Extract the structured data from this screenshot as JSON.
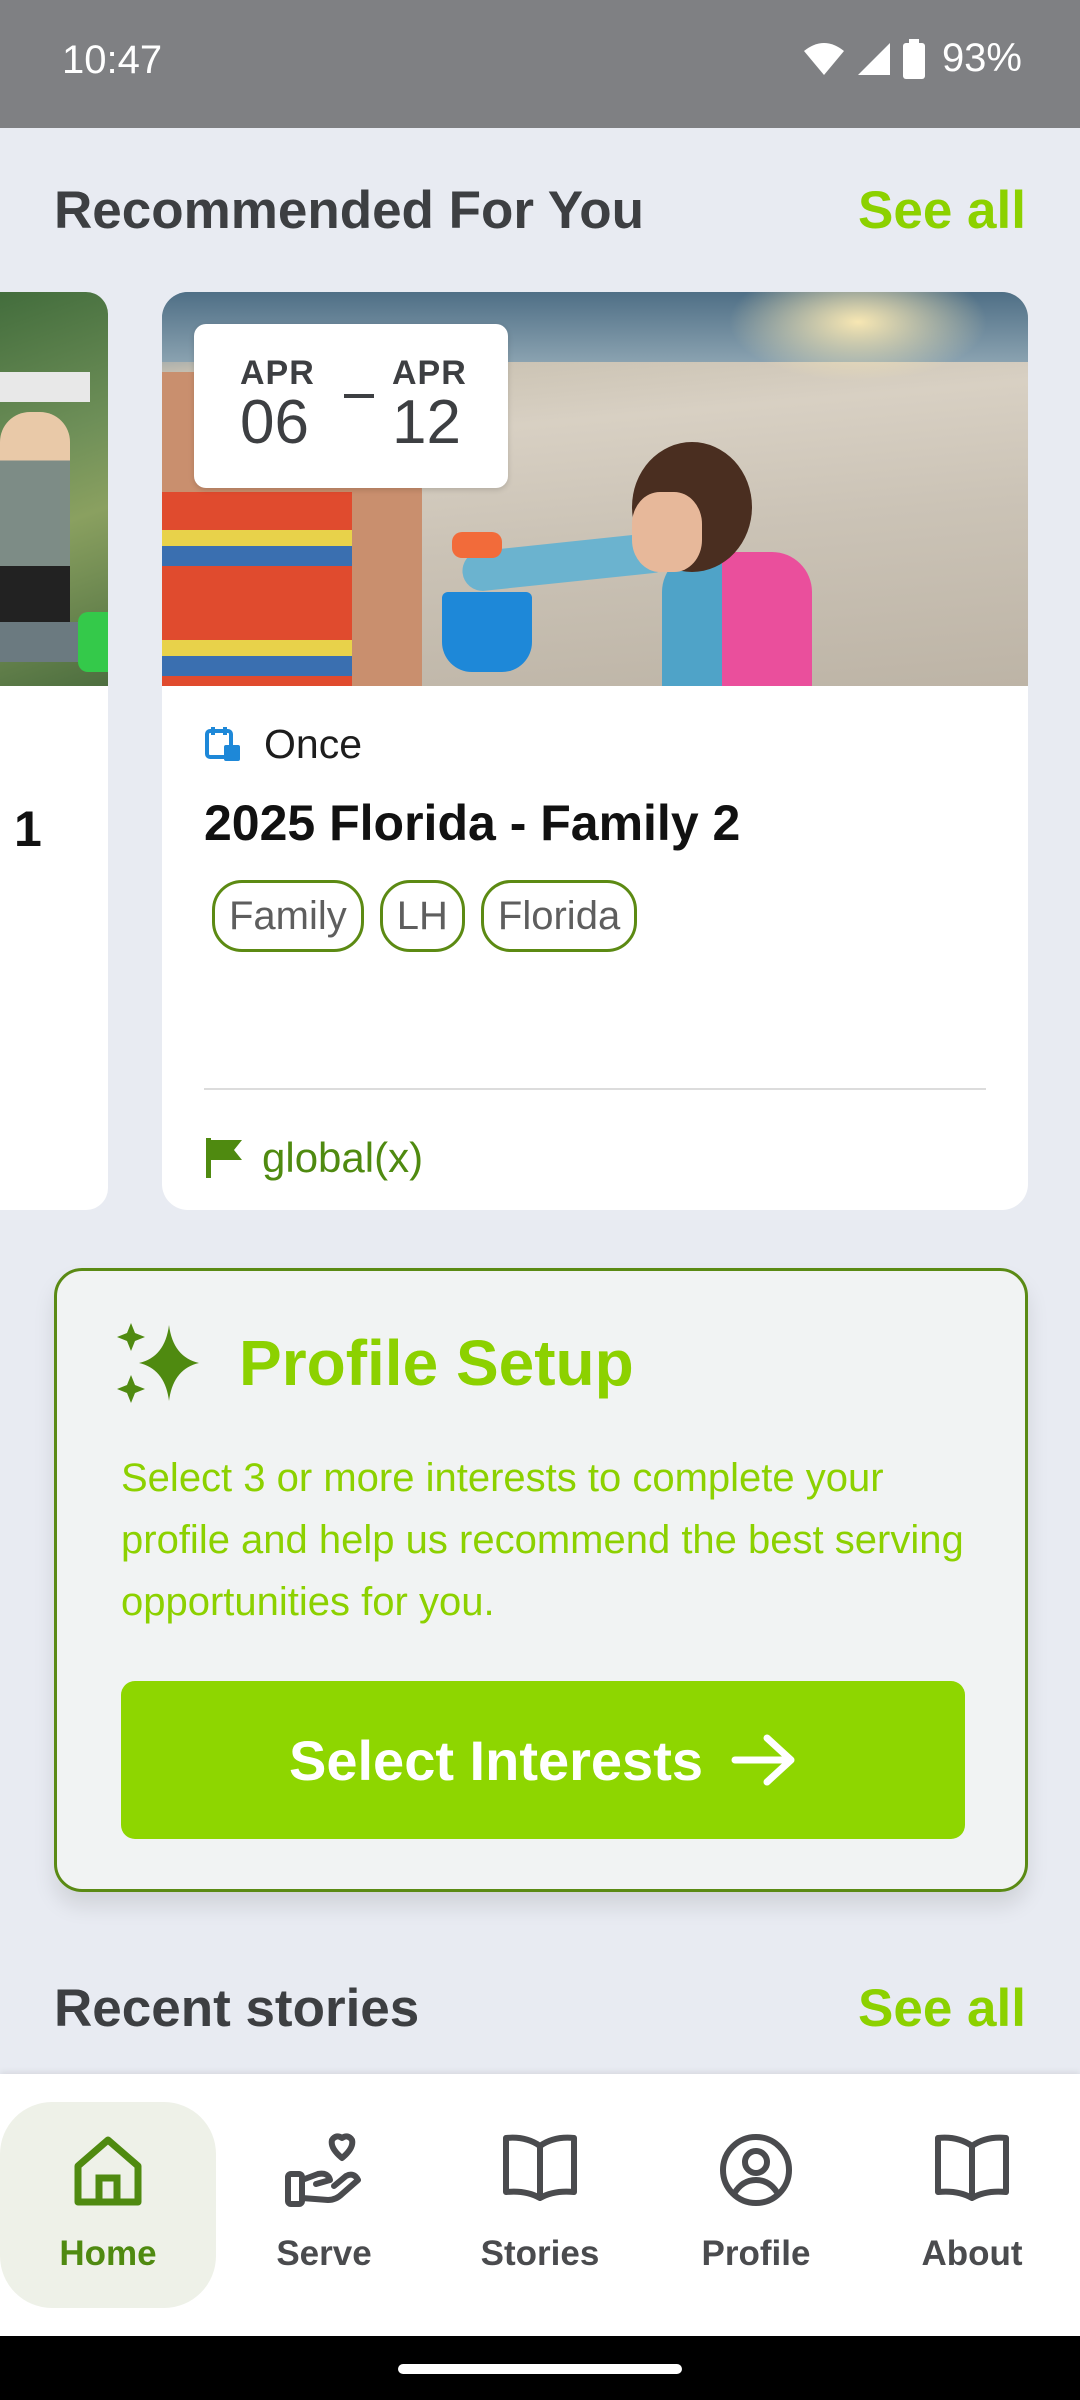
{
  "status_bar": {
    "time": "10:47",
    "battery": "93%"
  },
  "recommended": {
    "title": "Recommended For You",
    "see_all": "See all"
  },
  "partial_card": {
    "title_fragment": "1"
  },
  "event_card": {
    "date_from": {
      "month": "APR",
      "day": "06"
    },
    "date_to": {
      "month": "APR",
      "day": "12"
    },
    "frequency": "Once",
    "title": "2025 Florida - Family 2",
    "tags": [
      "Family",
      "LH",
      "Florida"
    ],
    "organization": "global(x)"
  },
  "profile_setup": {
    "title": "Profile Setup",
    "description": "Select 3 or more interests to complete your profile and help us recommend the best serving opportunities for you.",
    "button_label": "Select Interests"
  },
  "recent_stories": {
    "title": "Recent stories",
    "see_all": "See all"
  },
  "nav": {
    "items": [
      {
        "label": "Home",
        "icon": "home-icon",
        "active": true
      },
      {
        "label": "Serve",
        "icon": "serve-icon",
        "active": false
      },
      {
        "label": "Stories",
        "icon": "book-icon",
        "active": false
      },
      {
        "label": "Profile",
        "icon": "profile-icon",
        "active": false
      },
      {
        "label": "About",
        "icon": "book-icon",
        "active": false
      }
    ]
  },
  "colors": {
    "accent_green": "#8cd100",
    "dark_green": "#4f8a10",
    "background": "#e8ebf2"
  }
}
